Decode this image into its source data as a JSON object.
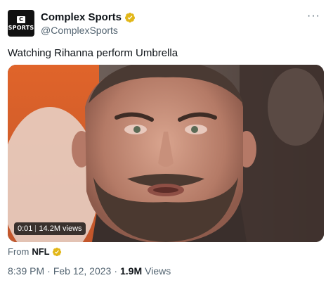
{
  "tweet": {
    "display_name": "Complex Sports",
    "handle": "@ComplexSports",
    "avatar_letter": "C",
    "avatar_text": "SPORTS",
    "more_label": "···",
    "text": "Watching Rihanna perform Umbrella",
    "video": {
      "time": "0:01",
      "views": "14.2M views"
    },
    "source": {
      "prefix": "From",
      "name": "NFL"
    },
    "meta": {
      "time": "8:39 PM",
      "separator1": "·",
      "date": "Feb 12, 2023",
      "separator2": "·",
      "views_count": "1.9M",
      "views_label": "Views"
    }
  },
  "colors": {
    "verified_gold": "#e2b719",
    "secondary_text": "#536471",
    "primary_text": "#0f1419"
  },
  "icons": {
    "verified": "verified-badge-icon",
    "more": "more-horizontal-icon"
  }
}
